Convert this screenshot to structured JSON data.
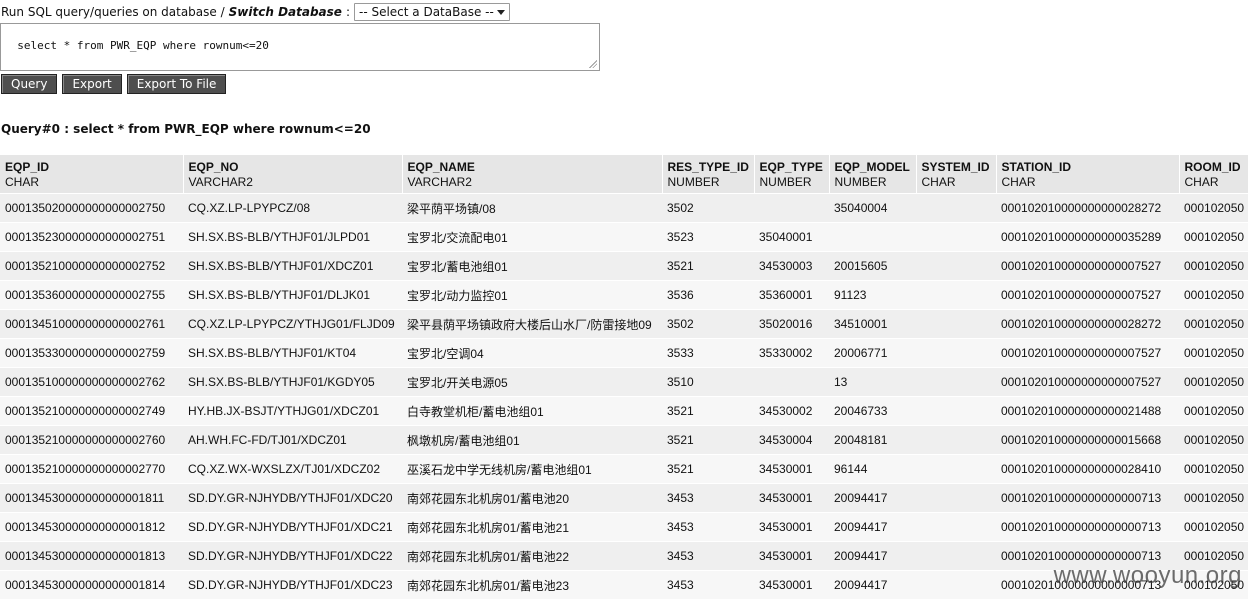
{
  "header": {
    "run_label": "Run SQL query/queries on database /",
    "switch_label": "Switch Database",
    "colon": ":",
    "db_select_value": "-- Select a DataBase --"
  },
  "sql_input": {
    "value": "select * from PWR_EQP where rownum<=20"
  },
  "buttons": {
    "query": "Query",
    "export": "Export",
    "export_file": "Export To File"
  },
  "query_title": "Query#0 : select * from PWR_EQP where rownum<=20",
  "table": {
    "columns": [
      {
        "name": "EQP_ID",
        "type": "CHAR"
      },
      {
        "name": "EQP_NO",
        "type": "VARCHAR2"
      },
      {
        "name": "EQP_NAME",
        "type": "VARCHAR2"
      },
      {
        "name": "RES_TYPE_ID",
        "type": "NUMBER"
      },
      {
        "name": "EQP_TYPE",
        "type": "NUMBER"
      },
      {
        "name": "EQP_MODEL",
        "type": "NUMBER"
      },
      {
        "name": "SYSTEM_ID",
        "type": "CHAR"
      },
      {
        "name": "STATION_ID",
        "type": "CHAR"
      },
      {
        "name": "ROOM_ID",
        "type": "CHAR"
      }
    ],
    "rows": [
      [
        "000135020000000000002750",
        "CQ.XZ.LP-LPYPCZ/08",
        "梁平荫平场镇/08",
        "3502",
        "",
        "35040004",
        "",
        "000102010000000000028272",
        "000102050"
      ],
      [
        "000135230000000000002751",
        "SH.SX.BS-BLB/YTHJF01/JLPD01",
        "宝罗北/交流配电01",
        "3523",
        "35040001",
        "",
        "",
        "000102010000000000035289",
        "000102050"
      ],
      [
        "000135210000000000002752",
        "SH.SX.BS-BLB/YTHJF01/XDCZ01",
        "宝罗北/蓄电池组01",
        "3521",
        "34530003",
        "20015605",
        "",
        "000102010000000000007527",
        "000102050"
      ],
      [
        "000135360000000000002755",
        "SH.SX.BS-BLB/YTHJF01/DLJK01",
        "宝罗北/动力监控01",
        "3536",
        "35360001",
        "91123",
        "",
        "000102010000000000007527",
        "000102050"
      ],
      [
        "000134510000000000002761",
        "CQ.XZ.LP-LPYPCZ/YTHJG01/FLJD09",
        "梁平县荫平场镇政府大楼后山水厂/防雷接地09",
        "3502",
        "35020016",
        "34510001",
        "",
        "000102010000000000028272",
        "000102050"
      ],
      [
        "000135330000000000002759",
        "SH.SX.BS-BLB/YTHJF01/KT04",
        "宝罗北/空调04",
        "3533",
        "35330002",
        "20006771",
        "",
        "000102010000000000007527",
        "000102050"
      ],
      [
        "000135100000000000002762",
        "SH.SX.BS-BLB/YTHJF01/KGDY05",
        "宝罗北/开关电源05",
        "3510",
        "",
        "13",
        "",
        "000102010000000000007527",
        "000102050"
      ],
      [
        "000135210000000000002749",
        "HY.HB.JX-BSJT/YTHJG01/XDCZ01",
        "白寺教堂机柜/蓄电池组01",
        "3521",
        "34530002",
        "20046733",
        "",
        "000102010000000000021488",
        "000102050"
      ],
      [
        "000135210000000000002760",
        "AH.WH.FC-FD/TJ01/XDCZ01",
        "枫墩机房/蓄电池组01",
        "3521",
        "34530004",
        "20048181",
        "",
        "000102010000000000015668",
        "000102050"
      ],
      [
        "000135210000000000002770",
        "CQ.XZ.WX-WXSLZX/TJ01/XDCZ02",
        "巫溪石龙中学无线机房/蓄电池组01",
        "3521",
        "34530001",
        "96144",
        "",
        "000102010000000000028410",
        "000102050"
      ],
      [
        "000134530000000000001811",
        "SD.DY.GR-NJHYDB/YTHJF01/XDC20",
        "南郊花园东北机房01/蓄电池20",
        "3453",
        "34530001",
        "20094417",
        "",
        "000102010000000000000713",
        "000102050"
      ],
      [
        "000134530000000000001812",
        "SD.DY.GR-NJHYDB/YTHJF01/XDC21",
        "南郊花园东北机房01/蓄电池21",
        "3453",
        "34530001",
        "20094417",
        "",
        "000102010000000000000713",
        "000102050"
      ],
      [
        "000134530000000000001813",
        "SD.DY.GR-NJHYDB/YTHJF01/XDC22",
        "南郊花园东北机房01/蓄电池22",
        "3453",
        "34530001",
        "20094417",
        "",
        "000102010000000000000713",
        "000102050"
      ],
      [
        "000134530000000000001814",
        "SD.DY.GR-NJHYDB/YTHJF01/XDC23",
        "南郊花园东北机房01/蓄电池23",
        "3453",
        "34530001",
        "20094417",
        "",
        "000102010000000000000713",
        "000102050"
      ]
    ]
  },
  "watermark": "www.wooyun.org"
}
